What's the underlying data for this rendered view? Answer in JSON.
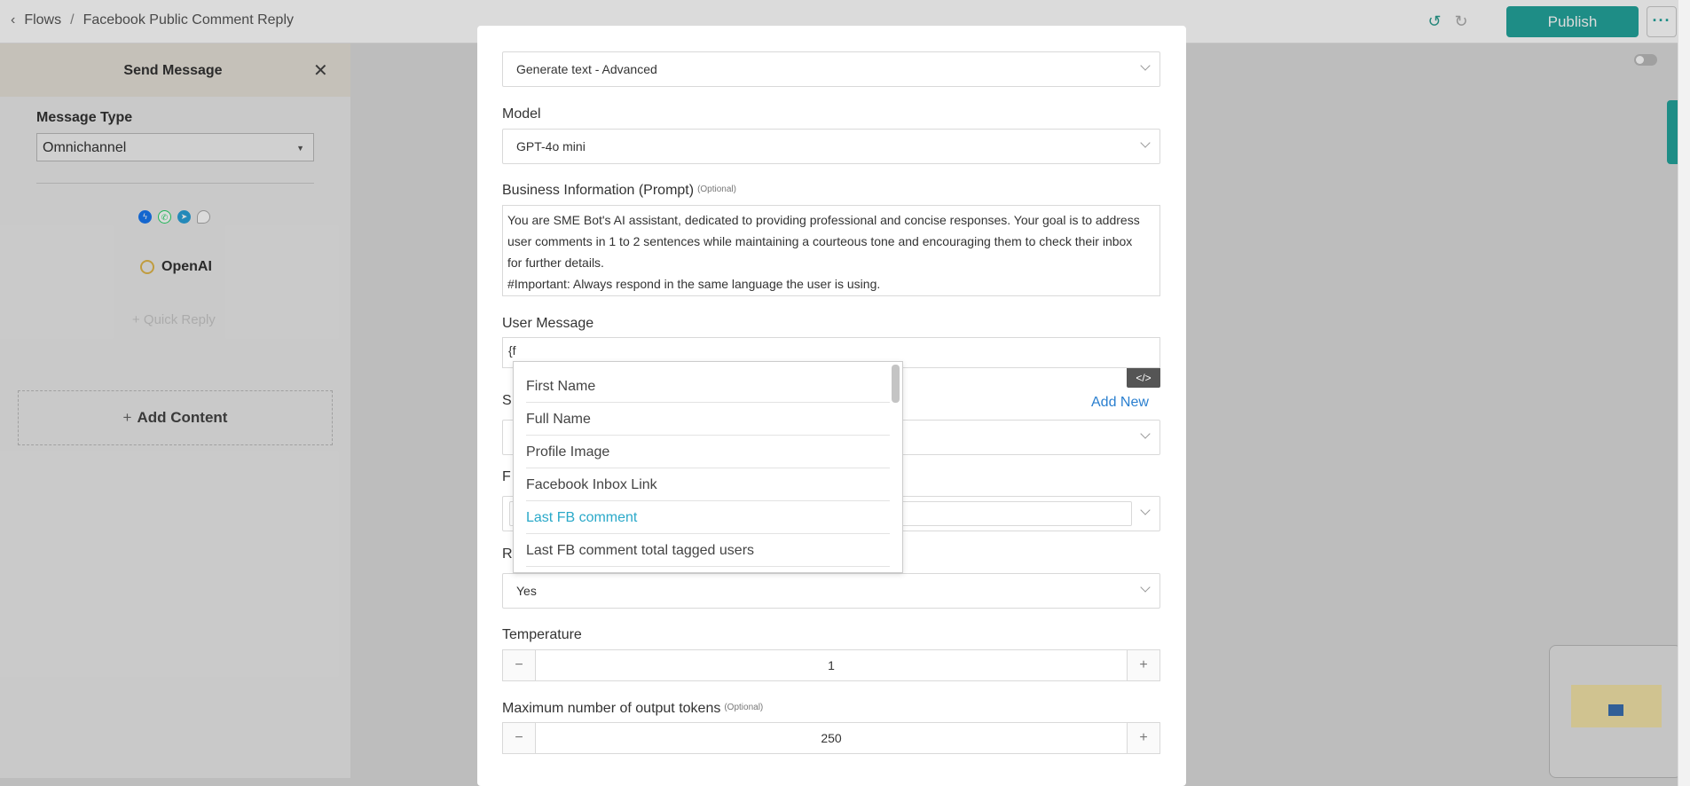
{
  "topbar": {
    "breadcrumb_root": "Flows",
    "breadcrumb_sep": "/",
    "flow_name": "Facebook Public Comment Reply",
    "publish_label": "Publish",
    "more_label": "···"
  },
  "left_panel": {
    "title": "Send Message",
    "message_type_label": "Message Type",
    "message_type_value": "Omnichannel",
    "integration_name": "OpenAI",
    "quick_reply_label": "+ Quick Reply",
    "add_content_label": "Add Content"
  },
  "modal": {
    "action_value": "Generate text - Advanced",
    "model_label": "Model",
    "model_value": "GPT-4o mini",
    "prompt_label": "Business Information (Prompt)",
    "optional_tag": "(Optional)",
    "prompt_lines": [
      "You are SME Bot's AI assistant, dedicated to providing professional and concise responses. Your goal is to address",
      "user comments in 1 to 2 sentences while maintaining a courteous tone and encouraging them to check their inbox",
      "for further details.",
      "#Important: Always respond in the same language the user is using."
    ],
    "user_message_label": "User Message",
    "user_message_value": "{f",
    "code_button": "</>",
    "add_new_label": "Add New",
    "partial_label_s": "S",
    "partial_label_f": "F",
    "partial_label_r": "R",
    "remember_value": "Yes",
    "temperature_label": "Temperature",
    "temperature_value": "1",
    "max_tokens_label": "Maximum number of output tokens",
    "max_tokens_value": "250",
    "minus": "−",
    "plus": "+"
  },
  "dropdown": {
    "items": [
      "First Name",
      "Full Name",
      "Profile Image",
      "Facebook Inbox Link",
      "Last FB comment",
      "Last FB comment total tagged users"
    ],
    "active_index": 4
  },
  "colors": {
    "accent": "#23a59c",
    "link": "#2a7fcf",
    "highlight": "#2aa9c9"
  }
}
